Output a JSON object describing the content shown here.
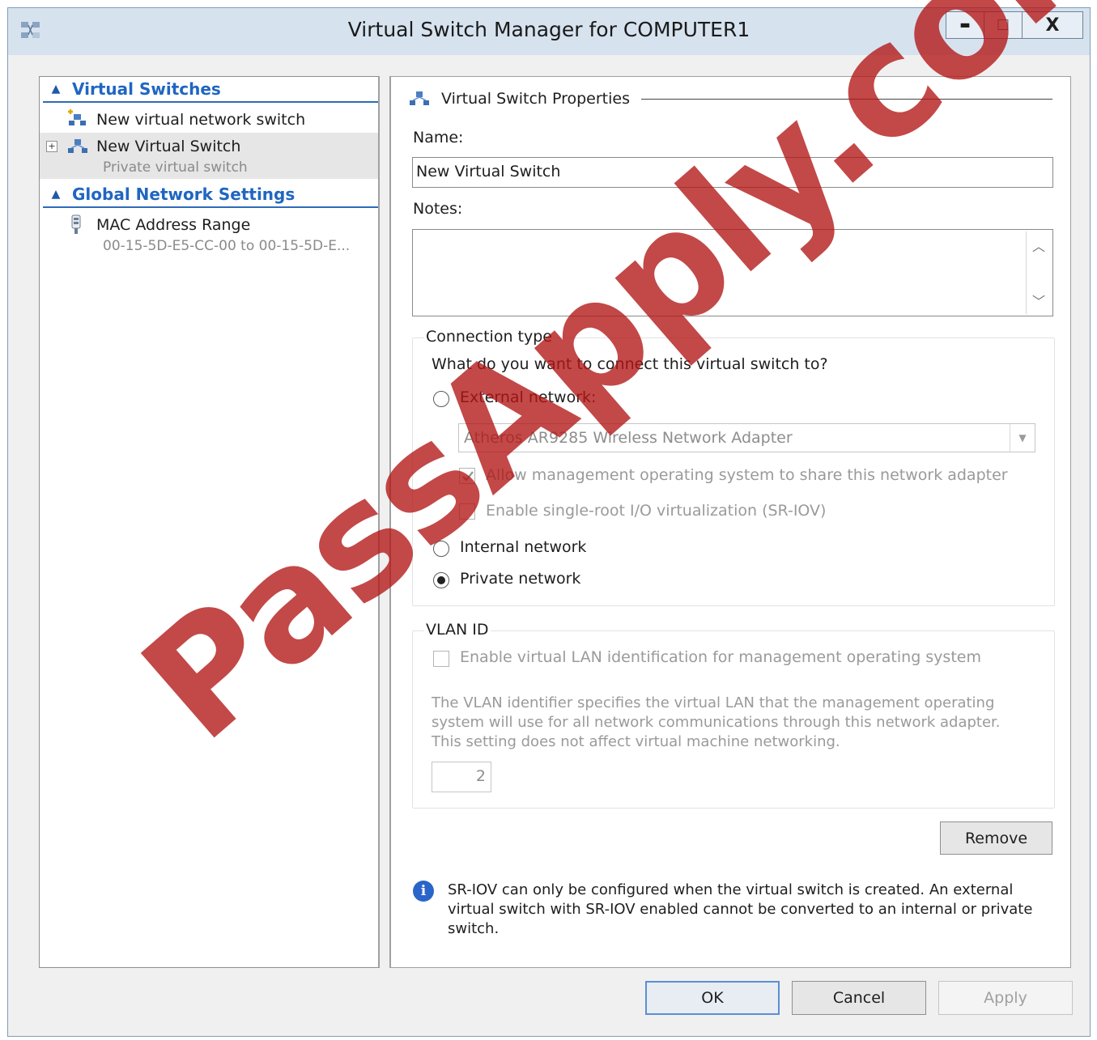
{
  "window": {
    "title": "Virtual Switch Manager for COMPUTER1",
    "controls": {
      "minimize": "▬",
      "maximize": "☐",
      "close": "X"
    }
  },
  "sidebar": {
    "virtual_switches_header": "Virtual Switches",
    "items": [
      {
        "label": "New virtual network switch",
        "icon": "new-switch-icon"
      },
      {
        "label": "New Virtual Switch",
        "sub": "Private virtual switch",
        "icon": "network-switch-icon",
        "expander": "+"
      }
    ],
    "global_header": "Global Network Settings",
    "global_items": [
      {
        "label": "MAC Address Range",
        "sub": "00-15-5D-E5-CC-00 to 00-15-5D-E...",
        "icon": "nic-icon"
      }
    ]
  },
  "properties": {
    "header": "Virtual Switch Properties",
    "name_label": "Name:",
    "name_value": "New Virtual Switch",
    "notes_label": "Notes:",
    "notes_value": "",
    "connection_type": {
      "legend": "Connection type",
      "question": "What do you want to connect this virtual switch to?",
      "external_label": "External network:",
      "adapter_selected": "Atheros AR9285 Wireless Network Adapter",
      "allow_mgmt_label": "Allow management operating system to share this network adapter",
      "allow_mgmt_checked": true,
      "sriov_label": "Enable single-root I/O virtualization (SR-IOV)",
      "sriov_checked": false,
      "internal_label": "Internal network",
      "private_label": "Private network",
      "selected": "private"
    },
    "vlan": {
      "legend": "VLAN ID",
      "enable_label": "Enable virtual LAN identification for management operating system",
      "description": "The VLAN identifier specifies the virtual LAN that the management operating system will use for all network communications through this network adapter. This setting does not affect virtual machine networking.",
      "id_value": "2"
    },
    "remove_label": "Remove",
    "info_text": "SR-IOV can only be configured when the virtual switch is created. An external virtual switch with SR-IOV enabled cannot be converted to an internal or private switch."
  },
  "footer": {
    "ok_label": "OK",
    "cancel_label": "Cancel",
    "apply_label": "Apply"
  },
  "watermark": "PassApply.com",
  "colors": {
    "accent": "#1f66c1",
    "titlebar": "#d6e3ef",
    "watermark": "#b21414"
  }
}
